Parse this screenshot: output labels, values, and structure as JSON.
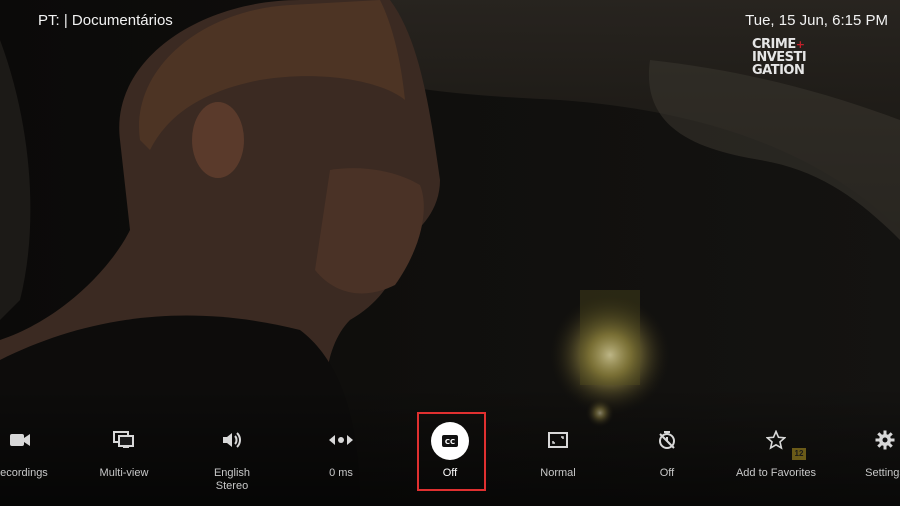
{
  "header": {
    "channel_label": "PT: | Documentários",
    "datetime": "Tue, 15 Jun, 6:15 PM"
  },
  "logo": {
    "line1": "CRIME",
    "line2": "INVESTI",
    "line3": "GATION",
    "plus": "+"
  },
  "controls": [
    {
      "icon": "video-camera-icon",
      "label": "Recordings",
      "label_line2": ""
    },
    {
      "icon": "multi-view-icon",
      "label": "Multi-view",
      "label_line2": ""
    },
    {
      "icon": "volume-icon",
      "label": "English",
      "label_line2": "Stereo"
    },
    {
      "icon": "audio-delay-icon",
      "label": "0 ms",
      "label_line2": ""
    },
    {
      "icon": "closed-captions-icon",
      "label": "Off",
      "label_line2": ""
    },
    {
      "icon": "aspect-ratio-icon",
      "label": "Normal",
      "label_line2": ""
    },
    {
      "icon": "sleep-timer-icon",
      "label": "Off",
      "label_line2": ""
    },
    {
      "icon": "star-icon",
      "label": "Add to Favorites",
      "label_line2": ""
    },
    {
      "icon": "gear-icon",
      "label": "Settings",
      "label_line2": ""
    }
  ],
  "favorites_badge": "12",
  "colors": {
    "focus_border": "#e03030",
    "logo_accent": "#c0202a"
  }
}
